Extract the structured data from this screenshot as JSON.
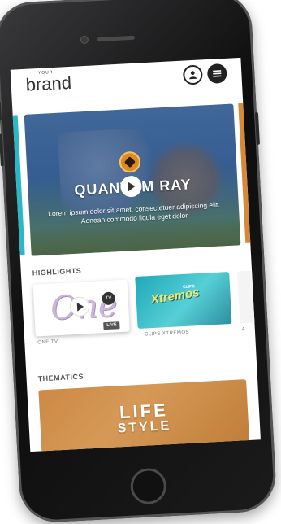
{
  "app": {
    "logo_small": "YOUR",
    "logo_brand": "brand"
  },
  "icons": {
    "user": "user-icon",
    "menu": "menu-icon",
    "play": "play-icon"
  },
  "hero": {
    "title": "QUANTUM RAY",
    "description": "Lorem ipsum dolor sit amet, consectetuer adipiscing elit. Aenean commodo ligula eget dolor"
  },
  "highlights": {
    "title": "HIGHLIGHTS",
    "cards": [
      {
        "caption": "ONE TV",
        "logo_text": "One",
        "tv_badge": "TV",
        "badge": "LIVE"
      },
      {
        "caption": "CLIPS XTREMOS",
        "logo_text": "Xtremos",
        "small_text": "CLIPS"
      },
      {
        "caption": "A"
      }
    ]
  },
  "thematics": {
    "title": "THEMATICS",
    "card": {
      "line1": "LIFE",
      "line2": "STYLE"
    }
  },
  "colors": {
    "header_icon": "#222222",
    "hero_blue": "#3d6fa6",
    "xtremos_teal": "#1fa8b8",
    "lifestyle_orange": "#d9a066"
  }
}
